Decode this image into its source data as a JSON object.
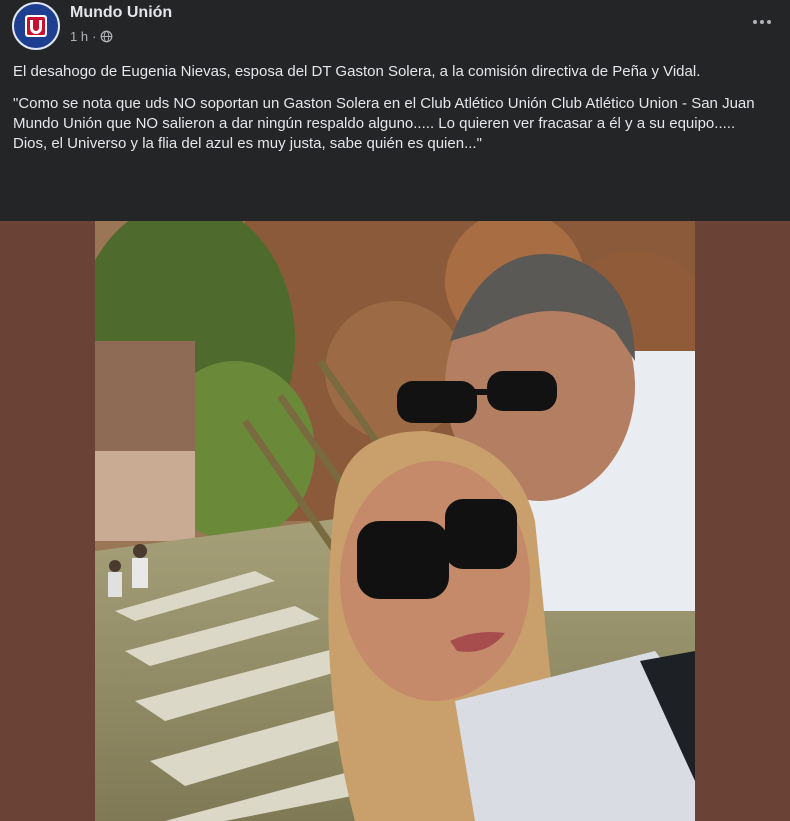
{
  "post": {
    "page_name": "Mundo Unión",
    "time": "1 h",
    "separator": "·",
    "paragraphs": [
      "El desahogo de Eugenia Nievas, esposa del DT Gaston Solera, a la comisión directiva de Peña y Vidal.",
      "\"Como se nota que uds NO soportan un Gaston Solera en el Club Atlético Unión Club Atlético Union  - San Juan Mundo Unión que NO salieron a dar ningún respaldo alguno..... Lo quieren ver fracasar a él y a su equipo..... Dios, el Universo y la flia del azul es muy justa, sabe quién es quien...\""
    ]
  },
  "icons": {
    "avatar": "club-crest-icon",
    "privacy": "globe-icon",
    "menu": "more-options-icon"
  },
  "colors": {
    "background": "#242526",
    "text": "#e4e6eb",
    "secondary_text": "#b0b3b8",
    "photo_backdrop": "#6b4236"
  }
}
